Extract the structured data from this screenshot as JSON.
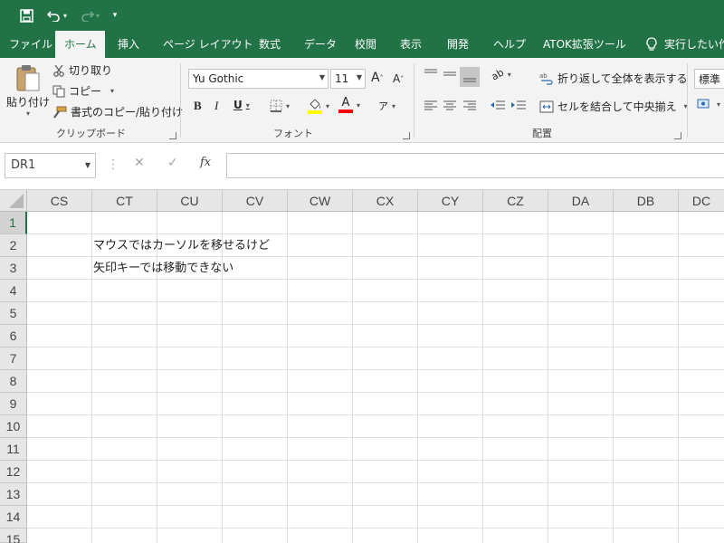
{
  "quick_access": {
    "save_icon": "save-icon",
    "undo_icon": "undo-icon",
    "redo_icon": "redo-icon",
    "customize_icon": "customize-qat-icon"
  },
  "tabs": [
    {
      "label": "ファイル"
    },
    {
      "label": "ホーム",
      "active": true
    },
    {
      "label": "挿入"
    },
    {
      "label": "ページ レイアウト"
    },
    {
      "label": "数式"
    },
    {
      "label": "データ"
    },
    {
      "label": "校閲"
    },
    {
      "label": "表示"
    },
    {
      "label": "開発"
    },
    {
      "label": "ヘルプ"
    },
    {
      "label": "ATOK拡張ツール"
    }
  ],
  "tell_me": "実行したい作",
  "clipboard": {
    "paste_label": "貼り付け",
    "cut_label": "切り取り",
    "copy_label": "コピー",
    "format_painter_label": "書式のコピー/貼り付け",
    "group_label": "クリップボード"
  },
  "font": {
    "font_name": "Yu Gothic",
    "font_size": "11",
    "increase_size": "A",
    "decrease_size": "A",
    "bold": "B",
    "italic": "I",
    "underline": "U",
    "font_color_letter": "A",
    "group_label": "フォント"
  },
  "alignment": {
    "wrap_text_label": "折り返して全体を表示する",
    "merge_center_label": "セルを結合して中央揃え",
    "group_label": "配置"
  },
  "number": {
    "format": "標準"
  },
  "formula_bar": {
    "name_box": "DR1",
    "cancel": "✕",
    "enter": "✓",
    "fx": "fx",
    "value": ""
  },
  "grid": {
    "columns": [
      "CS",
      "CT",
      "CU",
      "CV",
      "CW",
      "CX",
      "CY",
      "CZ",
      "DA",
      "DB",
      "DC"
    ],
    "rows": [
      "1",
      "2",
      "3",
      "4",
      "5",
      "6",
      "7",
      "8",
      "9",
      "10",
      "11",
      "12",
      "13",
      "14",
      "15"
    ],
    "selected_row": "1",
    "cells": {
      "CT2": "マウスではカーソルを移せるけど",
      "CT3": "矢印キーでは移動できない"
    }
  },
  "colors": {
    "brand": "#217346",
    "ribbon_bg": "#f3f3f3",
    "header_bg": "#e6e6e6",
    "fill_yellow": "#ffff00",
    "font_red": "#ff0000"
  }
}
